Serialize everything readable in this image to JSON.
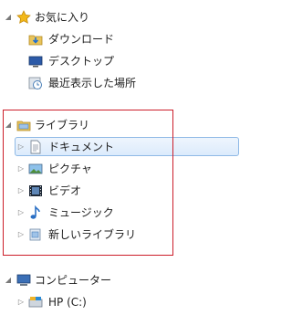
{
  "nav": {
    "favorites": {
      "label": "お気に入り",
      "icon": "star-icon"
    },
    "favorites_items": [
      {
        "label": "ダウンロード",
        "icon": "downloads-folder-icon"
      },
      {
        "label": "デスクトップ",
        "icon": "desktop-icon"
      },
      {
        "label": "最近表示した場所",
        "icon": "recent-places-icon"
      }
    ],
    "libraries": {
      "label": "ライブラリ",
      "icon": "library-icon"
    },
    "library_items": [
      {
        "label": "ドキュメント",
        "icon": "documents-icon"
      },
      {
        "label": "ピクチャ",
        "icon": "pictures-icon"
      },
      {
        "label": "ビデオ",
        "icon": "videos-icon"
      },
      {
        "label": "ミュージック",
        "icon": "music-icon"
      },
      {
        "label": "新しいライブラリ",
        "icon": "new-library-icon"
      }
    ],
    "computer": {
      "label": "コンピューター",
      "icon": "computer-icon"
    },
    "computer_items": [
      {
        "label": "HP (C:)",
        "icon": "hard-drive-icon"
      }
    ]
  },
  "colors": {
    "selection_border": "#8fb9e6",
    "highlight_box": "#cc1e2a",
    "star": "#f2b81a",
    "folder": "#e9c45a"
  }
}
